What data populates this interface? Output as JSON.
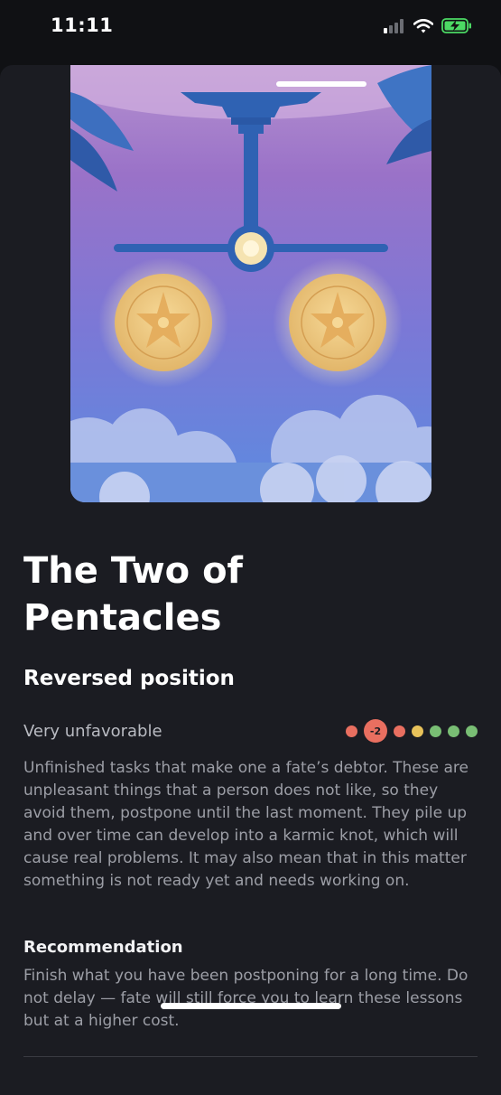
{
  "status_bar": {
    "time": "11:11",
    "icons": [
      "signal-icon",
      "wifi-icon",
      "battery-charging-icon"
    ]
  },
  "card": {
    "title": "The Two of Pentacles",
    "position": "Reversed position",
    "rating": {
      "label": "Very unfavorable",
      "value": "-2",
      "dot_colors": [
        "#e96f60",
        "#e96f60",
        "#e96f60",
        "#e8c25a",
        "#79be74",
        "#79be74",
        "#79be74"
      ]
    },
    "description": "Unfinished tasks that make one a fate’s debtor. These are unpleasant things that a person does not like, so they avoid them, postpone until the last moment. They pile up and over time can develop into a karmic knot, which will cause real problems. It may also mean that in this matter something is not ready yet and needs working on.",
    "recommendation": {
      "title": "Recommendation",
      "text": "Finish what you have been postponing for a long time. Do not delay — fate will still force you to learn these lessons but at a higher cost."
    }
  },
  "colors": {
    "background": "#1b1c22",
    "accent_purple": "#8a67c2",
    "accent_blue": "#5a86d6"
  }
}
